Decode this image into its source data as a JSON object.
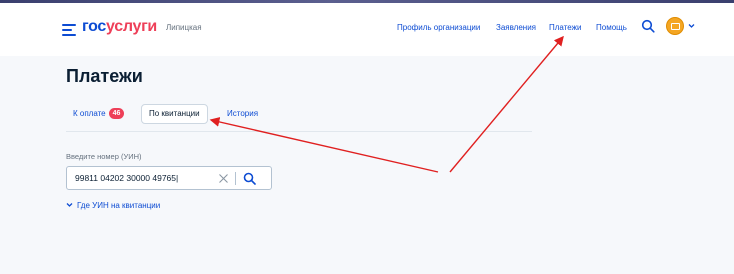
{
  "header": {
    "logo_part1": "гос",
    "logo_part2": "услуги",
    "region": "Липицкая",
    "nav": [
      "Профиль организации",
      "Заявления",
      "Платежи",
      "Помощь"
    ]
  },
  "page": {
    "title": "Платежи",
    "tabs": [
      {
        "label": "К оплате",
        "badge": "46"
      },
      {
        "label": "По квитанции"
      },
      {
        "label": "История"
      }
    ]
  },
  "uin": {
    "label": "Введите номер (УИН)",
    "value": "99811 04202 30000 49765|",
    "hint_link": "Где УИН на квитанции"
  },
  "colors": {
    "brand_blue": "#0d4cd3",
    "brand_red": "#ee3f58",
    "annotation_arrow": "#e02020",
    "avatar": "#f4a623"
  },
  "icons": [
    "menu-icon",
    "search-icon",
    "avatar-icon",
    "chevron-down-icon",
    "clear-icon",
    "search-icon"
  ]
}
